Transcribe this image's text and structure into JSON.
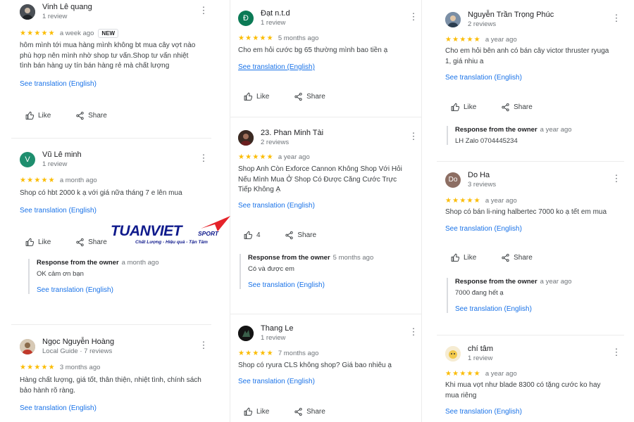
{
  "colors": {
    "link": "#1a73e8",
    "star": "#fbbc04",
    "logo_blue": "#0f1a8c",
    "logo_red": "#e5232a"
  },
  "labels": {
    "see_translation": "See translation (English)",
    "like": "Like",
    "share": "Share",
    "response_from_owner": "Response from the owner"
  },
  "logo": {
    "main": "TUANVIET",
    "sport": "SPORT",
    "tagline": "Chất Lượng - Hiệu quả - Tận Tâm"
  },
  "reviews": [
    {
      "name": "Vinh Lê quang",
      "subtitle": "1 review",
      "stars": "★★★★★",
      "time": "a week ago",
      "badge": "NEW",
      "text": "hôm mình tới mua hàng mình không bt mua cây vợt nào phù hợp nên mình nhờ shop tư vấn.Shop tư vấn nhiệt tình bán hàng uy tín bán hàng rẻ mà chất lượng",
      "avatar_icon": "person-photo-icon"
    },
    {
      "name": "Vũ Lê minh",
      "subtitle": "1 review",
      "stars": "★★★★★",
      "time": "a month ago",
      "text": "Shop có hbt 2000 k ạ với giá nữa tháng 7 e lên mua",
      "avatar_letter": "V",
      "response": {
        "time": "a month ago",
        "text": "OK cảm ơn bạn"
      }
    },
    {
      "name": "Ngọc Nguyễn Hoàng",
      "subtitle": "Local Guide · 7 reviews",
      "stars": "★★★★★",
      "time": "3 months ago",
      "text": "Hàng chất lượng, giá tốt, thân thiện, nhiệt tình, chính sách bảo hành rõ ràng.",
      "avatar_icon": "person-photo-icon"
    },
    {
      "name": "Đạt n.t.d",
      "subtitle": "1 review",
      "stars": "★★★★★",
      "time": "5 months ago",
      "text": "Cho em hỏi cước bg 65 thường mình bao tiền ạ",
      "avatar_letter": "Đ"
    },
    {
      "name": "23. Phan Minh Tài",
      "subtitle": "2 reviews",
      "stars": "★★★★★",
      "time": "a year ago",
      "text": "Shop Anh Còn Exforce Cannon Không Shop Với Hỏi Nếu Mình Mua Ở Shop Có Được Căng Cước Trực Tiếp Không Ạ",
      "like_count": "4",
      "avatar_icon": "person-photo-icon",
      "response": {
        "time": "5 months ago",
        "text": "Có và được em"
      }
    },
    {
      "name": "Thang Le",
      "subtitle": "1 review",
      "stars": "★★★★★",
      "time": "7 months ago",
      "text": "Shop có ryura CLS không shop? Giá bao nhiêu ạ",
      "avatar_icon": "person-photo-icon"
    },
    {
      "name": "Nguyễn Trần Trọng Phúc",
      "subtitle": "2 reviews",
      "stars": "★★★★★",
      "time": "a year ago",
      "text": "Cho em hỏi bên anh có bán cây victor thruster ryuga 1, giá nhiu a",
      "avatar_icon": "person-photo-icon",
      "response": {
        "time": "a year ago",
        "text": "LH Zalo 0704445234"
      }
    },
    {
      "name": "Do Ha",
      "subtitle": "3 reviews",
      "stars": "★★★★★",
      "time": "a year ago",
      "text": "Shop có bán li-ning halbertec 7000 ko ạ tết em mua",
      "avatar_letter": "Do",
      "response": {
        "time": "a year ago",
        "text": "7000 đang hết ạ"
      }
    },
    {
      "name": "chí tâm",
      "subtitle": "1 review",
      "stars": "★★★★★",
      "time": "a year ago",
      "text": "Khi mua vợt như blade 8300 có tặng cước ko hay mua riêng",
      "avatar_icon": "person-photo-icon"
    }
  ]
}
